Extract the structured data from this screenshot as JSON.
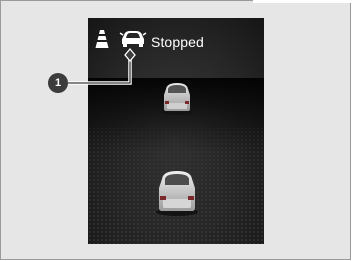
{
  "status": {
    "text": "Stopped"
  },
  "callout": {
    "number": "1"
  },
  "colors": {
    "frame_bg": "#e6e6e6",
    "display_bg": "#262626",
    "text": "#ffffff",
    "callout": "#3c3c3c"
  },
  "icons": [
    "lane-marker-icon",
    "vehicle-ahead-icon",
    "lead-vehicle-car-icon",
    "own-vehicle-car-icon"
  ]
}
